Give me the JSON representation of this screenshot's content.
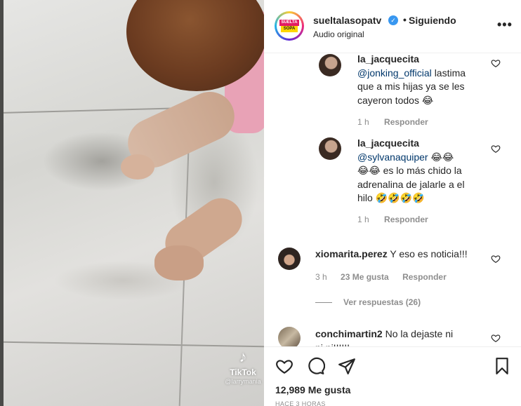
{
  "video": {
    "watermark": {
      "brand": "TikTok",
      "handle": "@larrymania"
    }
  },
  "post": {
    "username": "sueltalasopatv",
    "follow_status": "Siguiendo",
    "audio": "Audio original",
    "avatar_logo_top": "SUELTA",
    "avatar_logo_bottom": "SOPA"
  },
  "comments": [
    {
      "user": "la_jacquecita",
      "mention": "@jonking_official",
      "text_lines": [
        "lastima",
        "que a mis hijas ya se les",
        "cayeron todos 😂"
      ],
      "time": "1 h",
      "reply": "Responder"
    },
    {
      "user": "la_jacquecita",
      "mention": "@sylvanaquiper",
      "text_lines": [
        "😂😂",
        "😂😂 es lo más chido la",
        "adrenalina de jalarle a el",
        "hilo 🤣🤣🤣🤣"
      ],
      "time": "1 h",
      "reply": "Responder"
    },
    {
      "user": "xiomarita.perez",
      "text": "Y eso es noticia!!!",
      "time": "3 h",
      "likes": "23 Me gusta",
      "reply": "Responder",
      "view_replies": "Ver respuestas (26)"
    },
    {
      "user": "conchimartin2",
      "text_lines": [
        "No la dejaste ni",
        "ni ni!!!!!!"
      ]
    }
  ],
  "footer": {
    "likes": "12,989 Me gusta",
    "time": "HACE 3 HORAS"
  },
  "colors": {
    "verified": "#3897f0",
    "mention": "#00376b",
    "meta": "#8e8e8e"
  },
  "icons": [
    "more-options-icon",
    "verified-badge-icon",
    "heart-icon",
    "comment-icon",
    "share-icon",
    "bookmark-icon"
  ]
}
